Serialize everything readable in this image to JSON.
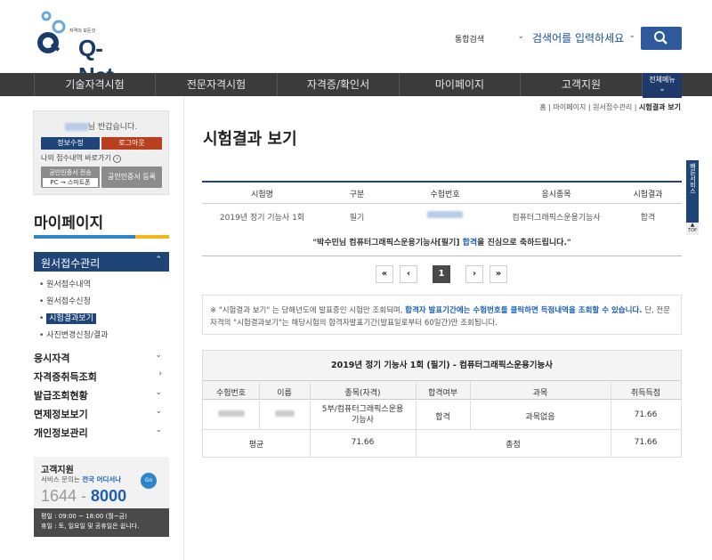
{
  "header": {
    "logo_tagline": "자격의 모든것",
    "logo_text": "Q-Net",
    "search_select": "통합검색",
    "search_placeholder": "검색어를 입력하세요"
  },
  "gnb": {
    "items": [
      "기술자격시험",
      "전문자격시험",
      "자격증/확인서",
      "마이페이지",
      "고객지원"
    ],
    "all_menu": "전체메뉴"
  },
  "login": {
    "greeting": "님 반갑습니다.",
    "edit_info": "정보수정",
    "logout": "로그아웃",
    "quick_link": "나의 접수내역 바로가기",
    "cert_transfer": "공인인증서 전송",
    "cert_pc": "PC → 스마트폰",
    "cert_register": "공인인증서 등록"
  },
  "sidebar": {
    "title": "마이페이지",
    "active_group": "원서접수관리",
    "sub_items": [
      "원서접수내역",
      "원서접수신청",
      "시험결과보기",
      "사진변경신청/결과"
    ],
    "groups": [
      "응시자격",
      "자격증취득조회",
      "발급조회현황",
      "면제정보보기",
      "개인정보관리"
    ]
  },
  "cs": {
    "title": "고객지원",
    "desc_prefix": "서비스 문의는",
    "desc_hl": "전국 어디서나",
    "phone_a": "1644 - ",
    "phone_b": "8000",
    "go": "Go",
    "hours": "평일 : 09:00 ~ 18:00 (월~금)",
    "holiday": "휴일 : 토, 일요일 및 공휴일은 쉽니다."
  },
  "breadcrumb": {
    "home": "홈",
    "mypage": "마이페이지",
    "apply": "원서접수관리",
    "current": "시험결과 보기"
  },
  "page_title": "시험결과 보기",
  "result_table": {
    "headers": [
      "시험명",
      "구분",
      "수험번호",
      "응시종목",
      "시험결과"
    ],
    "row": [
      "2019년 정기 기능사 1회",
      "필기",
      "",
      "컴퓨터그래픽스운용기능사",
      "합격"
    ],
    "congrats_a": "\"박수민님 컴퓨터그래픽스운용기능사[필기]",
    "congrats_hl": "합격",
    "congrats_b": "을 진심으로 축하드립니다.\""
  },
  "pager": {
    "first": "«",
    "prev": "‹",
    "current": "1",
    "next": "›",
    "last": "»"
  },
  "notice": {
    "a": "※ \"시험결과 보기\" 는 당해년도에 발표중인 시험만 조회되며,",
    "hl": "합격자 발표기간에는 수험번호를 클릭하면 득점내역을 조회할 수 있습니다.",
    "b": "단, 전문자격의 \"시험결과보기\"는 해당시험의 합격자발표기간(발표일로부터 60일간)만 조회됩니다."
  },
  "score_table": {
    "caption": "2019년 정기 기능사 1회 (필기) - 컴퓨터그래픽스운용기능사",
    "headers": [
      "수험번호",
      "이름",
      "종목(자격)",
      "합격여부",
      "과목",
      "취득득점"
    ],
    "row": [
      "",
      "",
      "5부/컴퓨터그래픽스운용기능사",
      "합격",
      "과목없음",
      "71.66"
    ],
    "avg_label": "평균",
    "avg_value": "71.66",
    "total_label": "총점",
    "total_value": "71.66"
  },
  "quick": {
    "label": "빠른서비스",
    "top": "TOP"
  }
}
